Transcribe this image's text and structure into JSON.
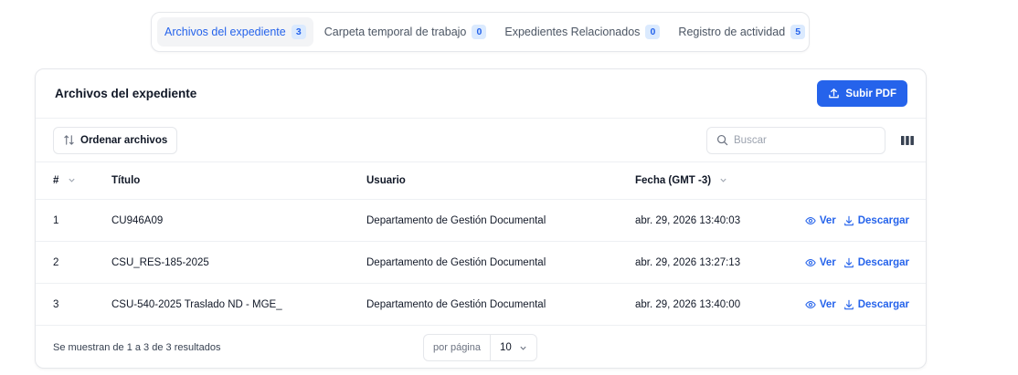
{
  "tabs": [
    {
      "label": "Archivos del expediente",
      "count": "3",
      "active": true
    },
    {
      "label": "Carpeta temporal de trabajo",
      "count": "0",
      "active": false
    },
    {
      "label": "Expedientes Relacionados",
      "count": "0",
      "active": false
    },
    {
      "label": "Registro de actividad",
      "count": "5",
      "active": false
    }
  ],
  "card": {
    "title": "Archivos del expediente",
    "upload_label": "Subir PDF"
  },
  "toolbar": {
    "sort_label": "Ordenar archivos",
    "search_placeholder": "Buscar",
    "search_value": ""
  },
  "table": {
    "headers": {
      "num": "#",
      "title": "Título",
      "user": "Usuario",
      "date": "Fecha (GMT -3)"
    },
    "rows": [
      {
        "num": "1",
        "title": "CU946A09",
        "user": "Departamento de Gestión Documental",
        "date": "abr. 29, 2026 13:40:03"
      },
      {
        "num": "2",
        "title": "CSU_RES-185-2025",
        "user": "Departamento de Gestión Documental",
        "date": "abr. 29, 2026 13:27:13"
      },
      {
        "num": "3",
        "title": "CSU-540-2025 Traslado ND - MGE_",
        "user": "Departamento de Gestión Documental",
        "date": "abr. 29, 2026 13:40:00"
      }
    ],
    "view_label": "Ver",
    "download_label": "Descargar"
  },
  "footer": {
    "summary": "Se muestran de 1 a 3 de 3 resultados",
    "per_page_label": "por página",
    "per_page_value": "10"
  },
  "colors": {
    "accent": "#2563eb",
    "badge_bg": "#dbeafe",
    "border": "#e5e7eb"
  }
}
